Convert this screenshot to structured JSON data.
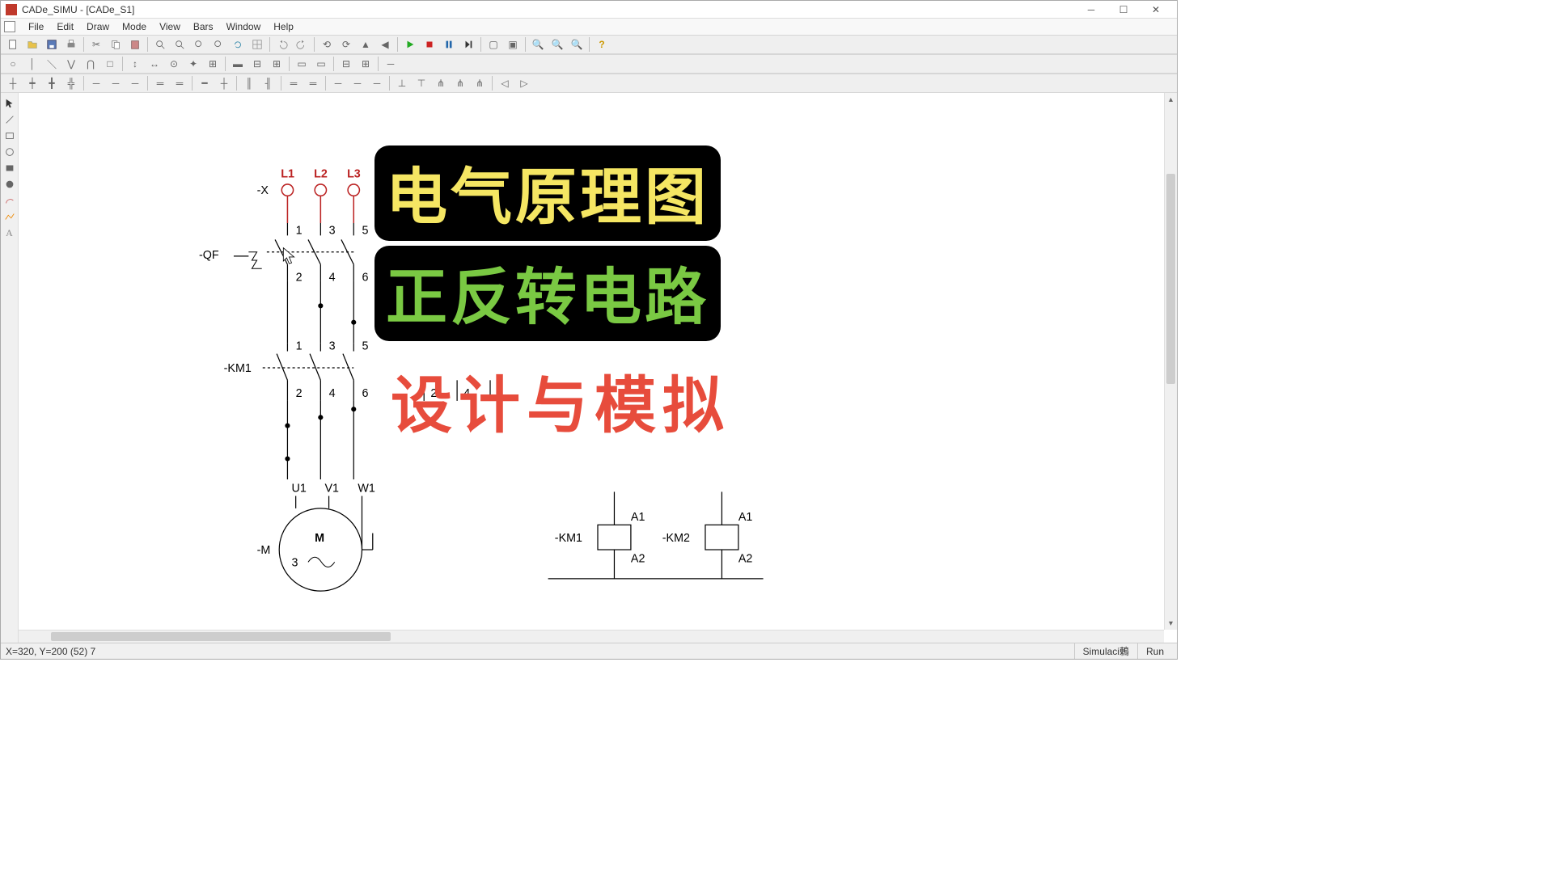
{
  "window": {
    "title": "CADe_SIMU - [CADe_S1]"
  },
  "menu": {
    "file": "File",
    "edit": "Edit",
    "draw": "Draw",
    "mode": "Mode",
    "view": "View",
    "bars": "Bars",
    "window": "Window",
    "help": "Help"
  },
  "overlay": {
    "line1": "电气原理图",
    "line2": "正反转电路",
    "line3": "设计与模拟"
  },
  "diagram": {
    "phases": {
      "L1": "L1",
      "L2": "L2",
      "L3": "L3"
    },
    "labels": {
      "X": "-X",
      "QF": "-QF",
      "KM1": "-KM1",
      "M": "-M",
      "KM1coil": "-KM1",
      "KM2coil": "-KM2"
    },
    "terms": {
      "top135": {
        "a": "1",
        "b": "3",
        "c": "5"
      },
      "bot246": {
        "a": "2",
        "b": "4",
        "c": "6"
      },
      "UVW": {
        "u": "U1",
        "v": "V1",
        "w": "W1"
      },
      "coil": {
        "top": "A1",
        "bot": "A2"
      },
      "motor": {
        "m": "M",
        "three": "3"
      }
    }
  },
  "status": {
    "coords": "X=320, Y=200 (52) 7",
    "sim": "Simulaci鶇",
    "run": "Run"
  }
}
